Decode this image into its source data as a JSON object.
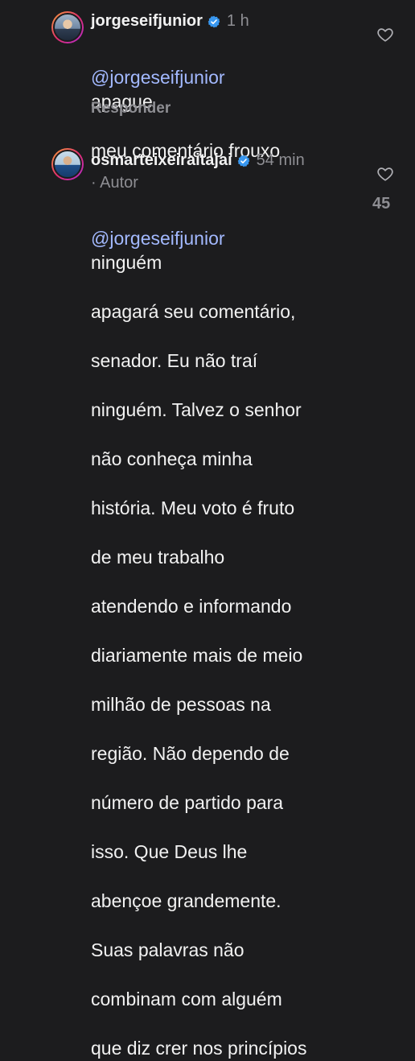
{
  "comments": [
    {
      "username": "jorgeseifjunior",
      "time": "1 h",
      "mention": "@jorgeseifjunior",
      "text": " apague meu comentário frouxo",
      "lines": [
        "apague",
        "meu comentário frouxo"
      ],
      "reply_label": "Responder",
      "icons": {
        "verified": "verified-badge-icon",
        "like": "heart-icon"
      }
    },
    {
      "username": "osmarteixeiraitajai",
      "time": "54 min",
      "author_label": "· Autor",
      "mention": "@jorgeseifjunior",
      "first_line_rest": "ninguém",
      "lines": [
        "apagará seu comentário,",
        "senador. Eu não traí",
        "ninguém. Talvez o senhor",
        "não conheça minha",
        "história. Meu voto é fruto",
        "de meu trabalho",
        "atendendo e informando",
        "diariamente mais de meio",
        "milhão de pessoas na",
        "região. Não dependo de",
        "número de partido para",
        "isso. Que Deus lhe",
        "abençoe grandemente.",
        "Suas palavras não",
        "combinam com alguém",
        "que diz crer nos princípios"
      ],
      "like_count": "45",
      "icons": {
        "verified": "verified-badge-icon",
        "like": "heart-icon"
      }
    }
  ],
  "colors": {
    "background": "#1c1c1e",
    "text": "#f2f2f2",
    "muted": "#8e8e93",
    "mention": "#a3b9ff",
    "verified": "#3897f0"
  }
}
